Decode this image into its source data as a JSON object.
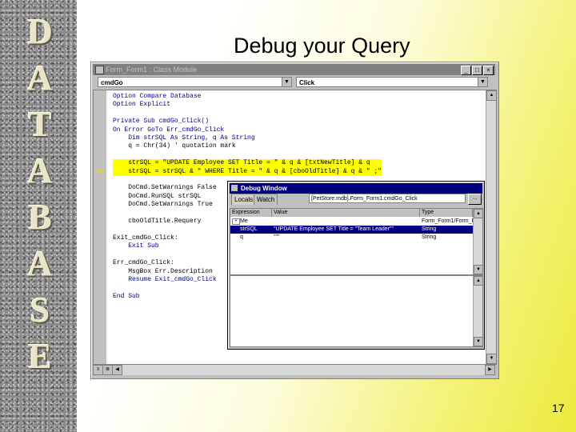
{
  "slide": {
    "title": "Debug your Query",
    "page_number": "17",
    "sidebar_letters": [
      "D",
      "A",
      "T",
      "A",
      "B",
      "A",
      "S",
      "E"
    ]
  },
  "code_window": {
    "title": "Form_Form1 : Class Module",
    "object_combo": "cmdGo",
    "procedure_combo": "Click",
    "code_lines": [
      "Option Compare Database",
      "Option Explicit",
      "",
      "Private Sub cmdGo_Click()",
      "On Error GoTo Err_cmdGo_Click",
      "    Dim strSQL As String, q As String",
      "    q = Chr(34) ' quotation mark",
      "",
      "    strSQL = \"UPDATE Employee SET Title = \" & q & [txtNewTitle] & q",
      "    strSQL = strSQL & \" WHERE Title = \" & q & [cboOldTitle] & q & \" ;\"",
      "",
      "    DoCmd.SetWarnings False",
      "    DoCmd.RunSQL strSQL",
      "    DoCmd.SetWarnings True",
      "",
      "    cboOldTitle.Requery",
      "",
      "Exit_cmdGo_Click:",
      "    Exit Sub",
      "",
      "Err_cmdGo_Click:",
      "    MsgBox Err.Description",
      "    Resume Exit_cmdGo_Click",
      "",
      "End Sub"
    ]
  },
  "debug_window": {
    "title": "Debug Window",
    "tabs": [
      "Locals",
      "Watch"
    ],
    "context": "[PetStore.mdb].Form_Form1.cmdGo_Click",
    "context_button": "...",
    "columns": [
      "Expression",
      "Value",
      "Type"
    ],
    "rows": [
      {
        "expander": "+",
        "expression": "Me",
        "value": "",
        "type": "Form_Form1/Form_Fo"
      },
      {
        "expander": "",
        "expression": "strSQL",
        "value": "\"UPDATE Employee SET Title = \"Team Leader\"\"",
        "type": "String"
      },
      {
        "expander": "",
        "expression": "q",
        "value": "\"\"\"",
        "type": "String"
      }
    ]
  },
  "colors": {
    "highlight_line": "#ffff00",
    "selected_row": "#000080",
    "title_bar_active": "#000080",
    "title_bar_inactive": "#808080"
  }
}
